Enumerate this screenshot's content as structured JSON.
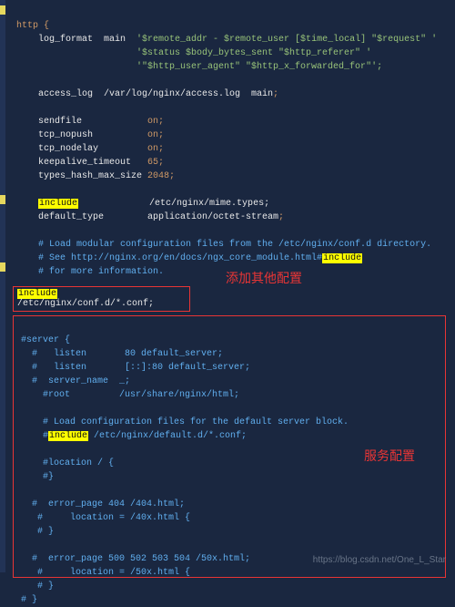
{
  "line0": "http {",
  "line1a": "    log_format  main  ",
  "line1b": "'$remote_addr - $remote_user [$time_local] \"$request\" '",
  "line2": "                      '$status $body_bytes_sent \"$http_referer\" '",
  "line3": "                      '\"$http_user_agent\" \"$http_x_forwarded_for\"';",
  "line5a": "    access_log  /var/log/nginx/access.log  main",
  "line5b": ";",
  "line7a": "    sendfile            ",
  "line7b": "on",
  "line7c": ";",
  "line8a": "    tcp_nopush          ",
  "line8b": "on",
  "line8c": ";",
  "line9a": "    tcp_nodelay         ",
  "line9b": "on",
  "line9c": ";",
  "line10a": "    keepalive_timeout   ",
  "line10b": "65",
  "line10c": ";",
  "line11a": "    types_hash_max_size ",
  "line11b": "2048",
  "line11c": ";",
  "line13a": "include",
  "line13b": "             /etc/nginx/mime.types;",
  "line14a": "    default_type        application/octet-stream",
  "line14b": ";",
  "line16": "    # Load modular configuration files from the /etc/nginx/conf.d directory.",
  "line17a": "    # See http://nginx.org/en/docs/ngx_core_module.html#",
  "line17b": "include",
  "line18": "    # for more information.",
  "boxA_a": "include",
  "boxA_b": " /etc/nginx/conf.d/*.conf;",
  "annot1": "添加其他配置",
  "s1": "#server {",
  "s2a": "  #   listen       ",
  "s2b": "80",
  "s2c": " default_server;",
  "s3": "  #   listen       [::]:80 default_server;",
  "s4": "  #  server_name  _;",
  "s5": "    #root         /usr/share/nginx/html;",
  "s7": "    # Load configuration files for the default server block.",
  "s8a": "    #",
  "s8b": "include",
  "s8c": " /etc/nginx/default.d/*.conf;",
  "s10": "    #location / {",
  "s11": "    #}",
  "annot2": "服务配置",
  "s13": "  #  error_page 404 /404.html;",
  "s14": "   #     location = /40x.html {",
  "s15": "   # }",
  "s17": "  #  error_page 500 502 503 504 /50x.html;",
  "s18": "   #     location = /50x.html {",
  "s19": "   # }",
  "s20": "# }",
  "watermark": "https://blog.csdn.net/One_L_Star"
}
